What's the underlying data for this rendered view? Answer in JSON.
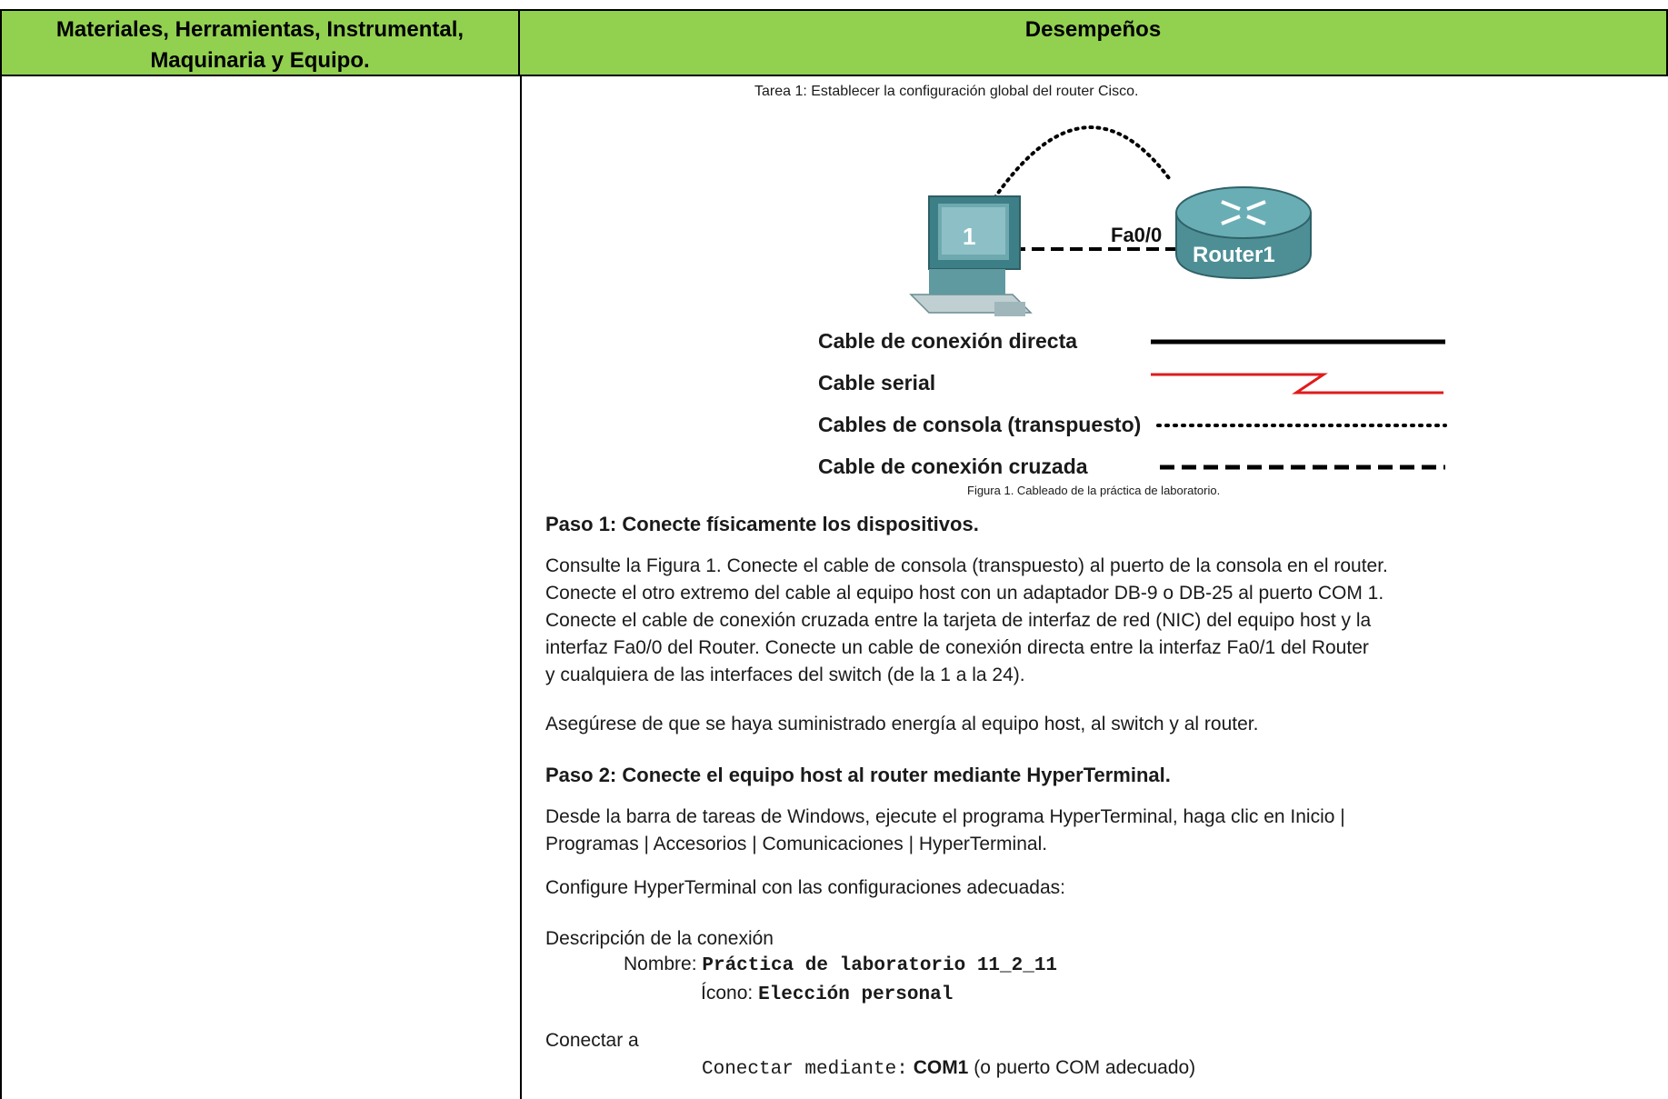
{
  "table": {
    "header_left": "Materiales, Herramientas, Instrumental, Maquinaria y Equipo.",
    "header_right": "Desempeños"
  },
  "task": {
    "title": "Tarea 1: Establecer la configuración global del router Cisco."
  },
  "diagram": {
    "pc_label": "1",
    "interface_label": "Fa0/0",
    "router_label": "Router1"
  },
  "legend": {
    "straight": "Cable de conexión directa",
    "serial": "Cable serial",
    "console": "Cables de consola (transpuesto)",
    "crossover": "Cable de conexión cruzada"
  },
  "figure_caption": "Figura 1. Cableado de la práctica de laboratorio.",
  "step1": {
    "title": "Paso 1: Conecte físicamente los dispositivos.",
    "lines": [
      "Consulte la Figura 1. Conecte el cable de consola (transpuesto) al puerto de la consola en el router.",
      "Conecte el otro extremo del cable al equipo host con un adaptador DB-9 o DB-25 al puerto COM 1.",
      "Conecte el cable de conexión cruzada entre la tarjeta de interfaz de red (NIC) del equipo host y la",
      "interfaz Fa0/0 del Router. Conecte un cable de conexión directa entre la interfaz Fa0/1 del Router",
      "y cualquiera de las interfaces del switch (de la 1 a la 24)."
    ],
    "power": "Asegúrese de que se haya suministrado energía al equipo host, al switch y al router."
  },
  "step2": {
    "title": "Paso 2: Conecte el equipo host al router mediante HyperTerminal.",
    "lines": [
      "Desde la barra de tareas de Windows, ejecute el programa HyperTerminal, haga clic en Inicio |",
      "Programas | Accesorios | Comunicaciones | HyperTerminal."
    ],
    "configure": "Configure HyperTerminal con las configuraciones adecuadas:",
    "desc_heading": "Descripción de la conexión",
    "name_label": "Nombre:",
    "name_value": "Práctica de laboratorio 11_2_11",
    "icon_label": "Ícono:",
    "icon_value": "Elección personal",
    "connect_heading": "Conectar a",
    "connect_label": "Conectar mediante:",
    "connect_value": "COM1",
    "connect_note": "(o puerto COM adecuado)"
  }
}
